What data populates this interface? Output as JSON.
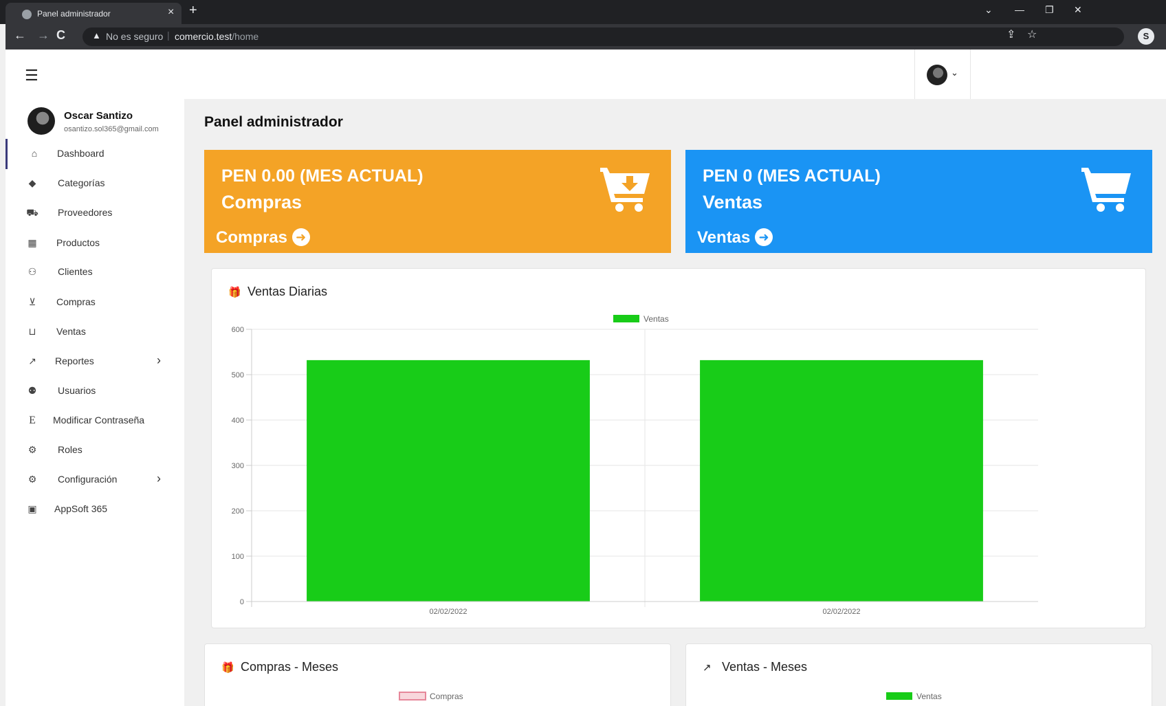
{
  "browser": {
    "tab_title": "Panel administrador",
    "security_label": "No es seguro",
    "url_host": "comercio.test",
    "url_path": "/home"
  },
  "user": {
    "name": "Oscar Santizo",
    "email": "osantizo.sol365@gmail.com"
  },
  "sidebar": {
    "items": [
      {
        "label": "Dashboard",
        "icon": "home-icon"
      },
      {
        "label": "Categorías",
        "icon": "tags-icon"
      },
      {
        "label": "Proveedores",
        "icon": "truck-icon"
      },
      {
        "label": "Productos",
        "icon": "boxes-icon"
      },
      {
        "label": "Clientes",
        "icon": "users-icon"
      },
      {
        "label": "Compras",
        "icon": "cart-arrow-down-icon"
      },
      {
        "label": "Ventas",
        "icon": "cart-icon"
      },
      {
        "label": "Reportes",
        "icon": "chart-line-icon"
      },
      {
        "label": "Usuarios",
        "icon": "user-group-icon"
      },
      {
        "label": "Modificar Contraseña",
        "icon": "letter-e-icon"
      },
      {
        "label": "Roles",
        "icon": "user-gear-icon"
      },
      {
        "label": "Configuración",
        "icon": "cogs-icon"
      },
      {
        "label": "AppSoft 365",
        "icon": "address-book-icon"
      }
    ]
  },
  "page": {
    "title": "Panel administrador"
  },
  "cards": {
    "compras": {
      "amount": "PEN 0.00 (MES ACTUAL)",
      "name": "Compras",
      "link": "Compras",
      "color": "#f4a326"
    },
    "ventas": {
      "amount": "PEN 0 (MES ACTUAL)",
      "name": "Ventas",
      "link": "Ventas",
      "color": "#1a94f4"
    }
  },
  "panels": {
    "daily": {
      "title": "Ventas Diarias"
    },
    "compras_meses": {
      "title": "Compras - Meses"
    },
    "ventas_meses": {
      "title": "Ventas - Meses"
    }
  },
  "chart_data": [
    {
      "type": "bar",
      "title": "Ventas Diarias",
      "categories": [
        "02/02/2022",
        "02/02/2022"
      ],
      "series": [
        {
          "name": "Ventas",
          "values": [
            532,
            532
          ],
          "color": "#18cc18"
        }
      ],
      "yticks": [
        0,
        100,
        200,
        300,
        400,
        500,
        600
      ],
      "ylim": [
        0,
        600
      ],
      "legend": "top",
      "grid": true
    },
    {
      "type": "bar",
      "title": "Compras - Meses",
      "series": [
        {
          "name": "Compras",
          "color": "#f8d7dc"
        }
      ],
      "legend": "top"
    },
    {
      "type": "bar",
      "title": "Ventas - Meses",
      "series": [
        {
          "name": "Ventas",
          "color": "#18cc18"
        }
      ],
      "legend": "top"
    }
  ]
}
